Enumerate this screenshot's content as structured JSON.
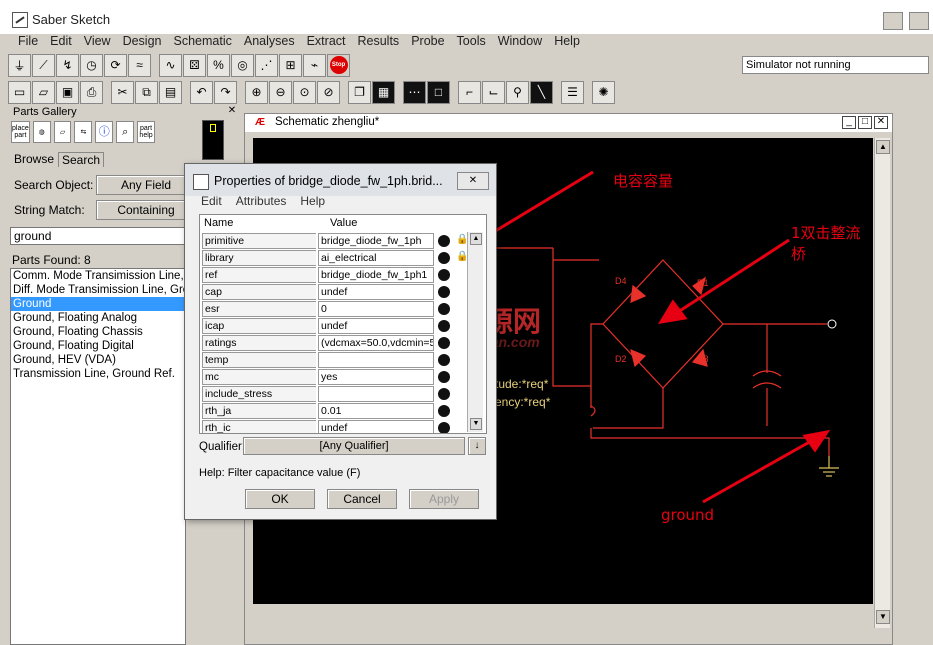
{
  "app": {
    "title": "Saber Sketch",
    "sim_status": "Simulator not running"
  },
  "menubar": [
    "File",
    "Edit",
    "View",
    "Design",
    "Schematic",
    "Analyses",
    "Extract",
    "Results",
    "Probe",
    "Tools",
    "Window",
    "Help"
  ],
  "toolbar_stop_label": "Stop",
  "gallery": {
    "title": "Parts Gallery",
    "tab_browse": "Browse",
    "tab_search": "Search",
    "search_object_label": "Search Object:",
    "search_object_value": "Any Field",
    "string_match_label": "String Match:",
    "string_match_value": "Containing",
    "search_text": "ground",
    "parts_found": "Parts Found:  8",
    "parts": [
      "Comm. Mode Transimission Line, Grou",
      "Diff. Mode Transimission Line, Groun",
      "Ground",
      "Ground, Floating Analog",
      "Ground, Floating Chassis",
      "Ground, Floating Digital",
      "Ground, HEV (VDA)",
      "Transmission Line, Ground Ref."
    ],
    "selected_index": 2,
    "mini_tabs": [
      "place part",
      "",
      "",
      "",
      "",
      "",
      "part help"
    ]
  },
  "schematic": {
    "title": "Schematic zhengliu*",
    "labels": {
      "amplitude": "tude:*req*",
      "frequency": "ency:*req*",
      "d1": "D1",
      "d2": "D2",
      "d3": "D3",
      "d4": "D4"
    },
    "annotations": {
      "cap": "电容容量",
      "bridge": "1双击整流桥",
      "ground": "ground"
    },
    "watermark": "电源网",
    "watermark_sub": "DianYuan.com"
  },
  "dialog": {
    "title": "Properties of bridge_diode_fw_1ph.brid...",
    "menu": [
      "Edit",
      "Attributes",
      "Help"
    ],
    "col_name": "Name",
    "col_value": "Value",
    "rows": [
      {
        "name": "primitive",
        "value": "bridge_diode_fw_1ph",
        "locked": true
      },
      {
        "name": "library",
        "value": "ai_electrical",
        "locked": true
      },
      {
        "name": "ref",
        "value": "bridge_diode_fw_1ph1",
        "locked": false
      },
      {
        "name": "cap",
        "value": "undef",
        "locked": false
      },
      {
        "name": "esr",
        "value": "0",
        "locked": false
      },
      {
        "name": "icap",
        "value": "undef",
        "locked": false
      },
      {
        "name": "ratings",
        "value": "(vdcmax=50.0,vdcmin=5",
        "locked": false
      },
      {
        "name": "temp",
        "value": "",
        "locked": false
      },
      {
        "name": "mc",
        "value": "yes",
        "locked": false
      },
      {
        "name": "include_stress",
        "value": "",
        "locked": false
      },
      {
        "name": "rth_ja",
        "value": "0.01",
        "locked": false
      },
      {
        "name": "rth_ic",
        "value": "undef",
        "locked": false
      }
    ],
    "qualifier_label": "Qualifier:",
    "qualifier_value": "[Any Qualifier]",
    "help_text": "Help:  Filter capacitance value (F)",
    "ok": "OK",
    "cancel": "Cancel",
    "apply": "Apply"
  }
}
